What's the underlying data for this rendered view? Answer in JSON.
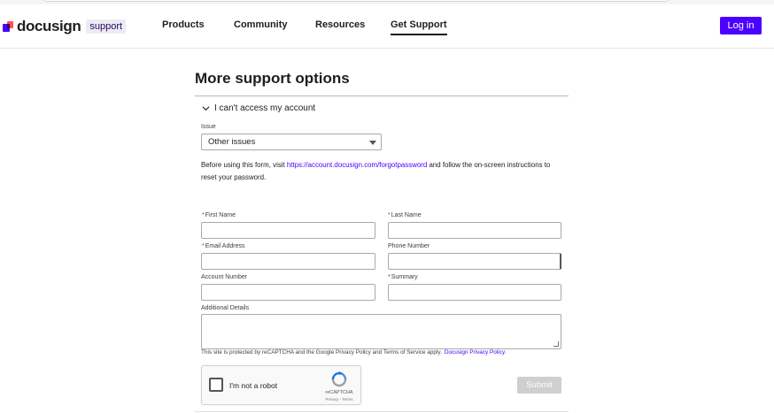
{
  "header": {
    "brand": "docusign",
    "brand_tag": "support",
    "nav": [
      "Products",
      "Community",
      "Resources",
      "Get Support"
    ],
    "login": "Log in"
  },
  "main": {
    "title": "More support options",
    "accordion_title": "I can't access my account",
    "issue": {
      "label": "Issue",
      "value": "Other issues"
    },
    "info": {
      "before": "Before using this form, visit ",
      "link": "https://account.docusign.com/forgotpassword",
      "after": " and follow the on-screen instructions to reset your password."
    },
    "fields": {
      "first_name": "First Name",
      "last_name": "Last Name",
      "email": "Email Address",
      "phone": "Phone Number",
      "account": "Account Number",
      "summary": "Summary",
      "details": "Additional Details"
    },
    "recaptcha_note": "This site is protected by reCAPTCHA and the Google Privacy Policy and Terms of Service apply.",
    "privacy_link": "Docusign Privacy Policy.",
    "captcha": {
      "label": "I'm not a robot",
      "brand": "reCAPTCHA",
      "links": "Privacy - Terms"
    },
    "submit": "Submit"
  },
  "colors": {
    "accent": "#4c00ff",
    "required": "#d01f1f",
    "disabled": "#cfcfcf"
  }
}
